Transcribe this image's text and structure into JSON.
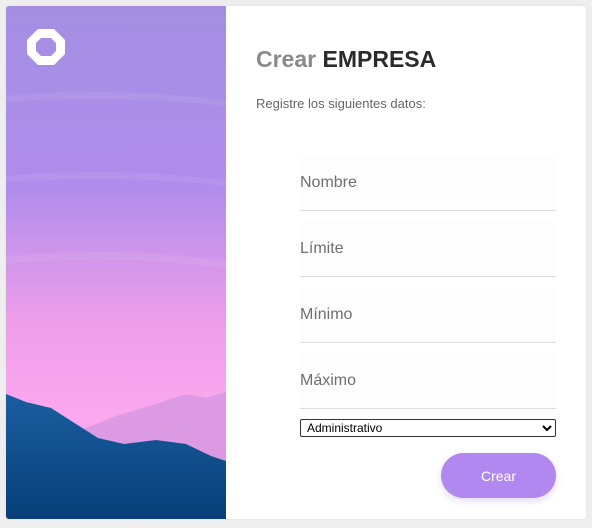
{
  "header": {
    "title_light": "Crear",
    "title_bold": "EMPRESA",
    "subtitle": "Registre los siguientes datos:"
  },
  "form": {
    "fields": [
      {
        "placeholder": "Nombre",
        "value": ""
      },
      {
        "placeholder": "Límite",
        "value": ""
      },
      {
        "placeholder": "Mínimo",
        "value": ""
      },
      {
        "placeholder": "Máximo",
        "value": ""
      }
    ],
    "select": {
      "selected": "Administrativo",
      "options": [
        "Administrativo"
      ]
    },
    "submit_label": "Crear"
  },
  "colors": {
    "accent": "#b188f0",
    "sky_top": "#9f8fe6",
    "sky_pink": "#f5a1ec",
    "mountain": "#0b4c8a"
  },
  "icons": {
    "logo": "octagon-ring-logo"
  }
}
